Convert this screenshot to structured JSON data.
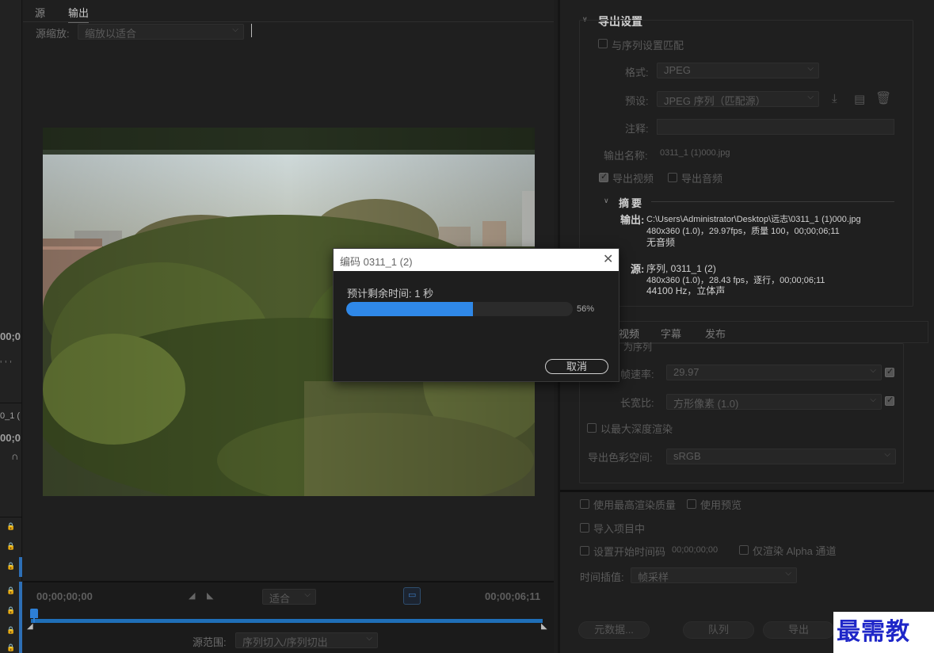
{
  "left_panel": {
    "tabs": [
      "源",
      "输出"
    ],
    "active_tab": 1,
    "source_scale_label": "源缩放:",
    "source_scale_value": "缩放以适合",
    "timecode_start": "00;00;00;00",
    "timecode_end": "00;00;06;11",
    "fit_value": "适合",
    "source_range_label": "源范围:",
    "source_range_value": "序列切入/序列切出"
  },
  "left_strip": {
    "texts": [
      "00;0",
      "0_1 (",
      "00;0",
      "∩"
    ]
  },
  "export_settings": {
    "title": "导出设置",
    "match_sequence_label": "与序列设置匹配",
    "format_label": "格式:",
    "format_value": "JPEG",
    "preset_label": "预设:",
    "preset_value": "JPEG 序列（匹配源）",
    "comment_label": "注释:",
    "output_name_label": "输出名称:",
    "output_name_value": "0311_1 (1)000.jpg",
    "export_video_label": "导出视频",
    "export_audio_label": "导出音频",
    "summary_title": "摘要",
    "output_label": "输出:",
    "output_line1": "C:\\Users\\Administrator\\Desktop\\远志\\0311_1  (1)000.jpg",
    "output_line2": "480x360 (1.0)，29.97fps，质量 100，00;00;06;11",
    "output_line3": "无音频",
    "source_label": "源:",
    "source_line1": "序列, 0311_1 (2)",
    "source_line2": "480x360 (1.0)，28.43 fps，逐行，00;00;06;11",
    "source_line3": "44100 Hz，立体声"
  },
  "video_tabs": [
    "视频",
    "字幕",
    "发布"
  ],
  "video_settings": {
    "match_partial": "为序列",
    "frame_rate_label": "帧速率:",
    "frame_rate_value": "29.97",
    "aspect_label": "长宽比:",
    "aspect_value": "方形像素 (1.0)",
    "max_depth_label": "以最大深度渲染",
    "color_space_label": "导出色彩空间:",
    "color_space_value": "sRGB"
  },
  "bottom_options": {
    "max_quality": "使用最高渲染质量",
    "use_preview": "使用预览",
    "import_project": "导入项目中",
    "set_start_tc": "设置开始时间码",
    "start_tc_value": "00;00;00;00",
    "alpha_only": "仅渲染 Alpha 通道",
    "interp_label": "时间插值:",
    "interp_value": "帧采样",
    "metadata_btn": "元数据...",
    "queue_btn": "队列",
    "export_btn": "导出"
  },
  "modal": {
    "title": "编码 0311_1 (2)",
    "remaining": "预计剩余时间: 1 秒",
    "progress": 0.56,
    "progress_text": "56%",
    "cancel": "取消"
  },
  "watermark": "最需教育"
}
